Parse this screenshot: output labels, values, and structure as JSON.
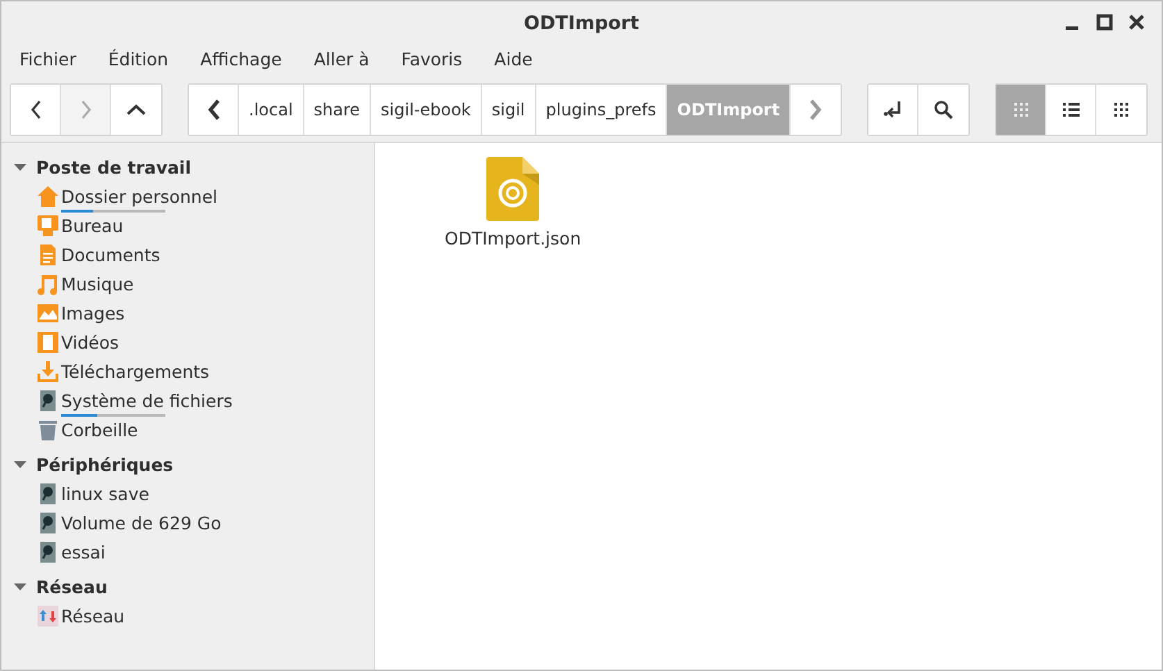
{
  "window": {
    "title": "ODTImport"
  },
  "menu": [
    "Fichier",
    "Édition",
    "Affichage",
    "Aller à",
    "Favoris",
    "Aide"
  ],
  "nav": [
    {
      "kind": "back",
      "disabled": false
    },
    {
      "kind": "forward",
      "disabled": true
    },
    {
      "kind": "up",
      "disabled": false
    }
  ],
  "path": {
    "crumbs": [
      {
        "label": ".local",
        "selected": false
      },
      {
        "label": "share",
        "selected": false
      },
      {
        "label": "sigil-ebook",
        "selected": false
      },
      {
        "label": "sigil",
        "selected": false
      },
      {
        "label": "plugins_prefs",
        "selected": false
      },
      {
        "label": "ODTImport",
        "selected": true
      }
    ]
  },
  "tools": [
    {
      "kind": "location"
    },
    {
      "kind": "search"
    }
  ],
  "views": [
    {
      "kind": "icons",
      "selected": true
    },
    {
      "kind": "list",
      "selected": false
    },
    {
      "kind": "compact",
      "selected": false
    }
  ],
  "sidebar": {
    "sections": [
      {
        "title": "Poste de travail",
        "expanded": true,
        "items": [
          {
            "label": "Dossier personnel",
            "kind": "home",
            "level": 0.3
          },
          {
            "label": "Bureau",
            "kind": "desktop"
          },
          {
            "label": "Documents",
            "kind": "document"
          },
          {
            "label": "Musique",
            "kind": "music"
          },
          {
            "label": "Images",
            "kind": "image"
          },
          {
            "label": "Vidéos",
            "kind": "video"
          },
          {
            "label": "Téléchargements",
            "kind": "download"
          },
          {
            "label": "Système de fichiers",
            "kind": "drive",
            "level": 0.34
          },
          {
            "label": "Corbeille",
            "kind": "trash"
          }
        ]
      },
      {
        "title": "Périphériques",
        "expanded": true,
        "items": [
          {
            "label": "linux save",
            "kind": "drive"
          },
          {
            "label": "Volume de 629 Go",
            "kind": "drive"
          },
          {
            "label": "essai",
            "kind": "drive"
          }
        ]
      },
      {
        "title": "Réseau",
        "expanded": true,
        "items": [
          {
            "label": "Réseau",
            "kind": "network"
          }
        ]
      }
    ]
  },
  "files": [
    {
      "name": "ODTImport.json",
      "kind": "json"
    }
  ]
}
